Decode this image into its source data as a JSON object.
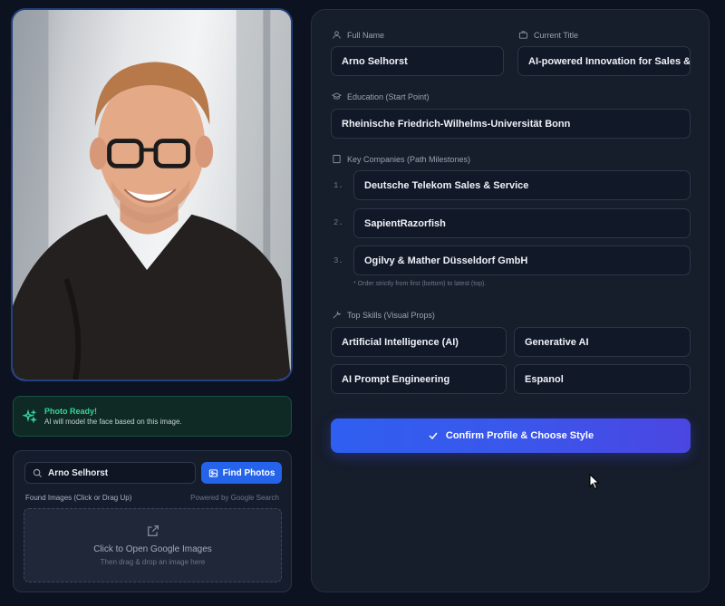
{
  "status": {
    "title": "Photo Ready!",
    "text": "AI will model the face based on this image.",
    "icon": "sparkles-icon",
    "color": "#34d399"
  },
  "search": {
    "value": "Arno Selhorst",
    "placeholder": "",
    "button_label": "Find Photos",
    "found_label": "Found Images (Click or Drag Up)",
    "powered_by": "Powered by Google Search",
    "drop_title": "Click to Open Google Images",
    "drop_subtitle": "Then drag & drop an image here"
  },
  "profile": {
    "full_name_label": "Full Name",
    "full_name": "Arno Selhorst",
    "title_label": "Current Title",
    "title": "AI-powered Innovation for Sales &",
    "education_label": "Education (Start Point)",
    "education": "Rheinische Friedrich-Wilhelms-Universität Bonn",
    "companies_label": "Key Companies (Path Milestones)",
    "companies": [
      {
        "num": "1.",
        "name": "Deutsche Telekom Sales & Service"
      },
      {
        "num": "2.",
        "name": "SapientRazorfish"
      },
      {
        "num": "3.",
        "name": "Ogilvy & Mather Düsseldorf GmbH"
      }
    ],
    "companies_note": "* Order strictly from first (bottom) to latest (top).",
    "skills_label": "Top Skills (Visual Props)",
    "skills": [
      "Artificial Intelligence (AI)",
      "Generative AI",
      "AI Prompt Engineering",
      "Espanol"
    ]
  },
  "confirm_label": "Confirm Profile & Choose Style",
  "colors": {
    "accent": "#2563eb",
    "background": "#0d1220",
    "panel": "#161d2b",
    "success": "#34d399"
  }
}
